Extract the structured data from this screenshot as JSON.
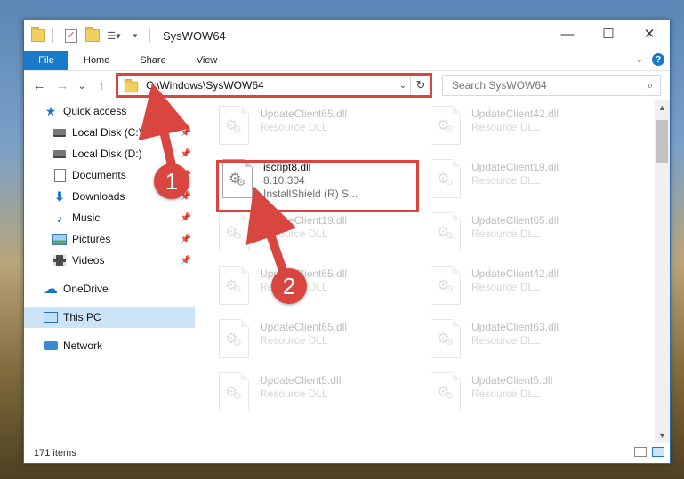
{
  "window": {
    "title": "SysWOW64",
    "controls": {
      "minimize": "—",
      "maximize": "☐",
      "close": "✕"
    }
  },
  "ribbon": {
    "file": "File",
    "tabs": [
      "Home",
      "Share",
      "View"
    ],
    "help": "?"
  },
  "navigation": {
    "back": "←",
    "forward": "→",
    "recent": "⌄",
    "up": "↑",
    "address": "C:\\Windows\\SysWOW64",
    "search_placeholder": "Search SysWOW64"
  },
  "sidebar": {
    "items": [
      {
        "label": "Quick access",
        "icon": "star-icon"
      },
      {
        "label": "Local Disk (C:)",
        "icon": "disk-icon",
        "pinned": true
      },
      {
        "label": "Local Disk (D:)",
        "icon": "disk-icon",
        "pinned": true
      },
      {
        "label": "Documents",
        "icon": "documents-icon",
        "pinned": true
      },
      {
        "label": "Downloads",
        "icon": "downloads-icon",
        "pinned": true
      },
      {
        "label": "Music",
        "icon": "music-icon",
        "pinned": true
      },
      {
        "label": "Pictures",
        "icon": "pictures-icon",
        "pinned": true
      },
      {
        "label": "Videos",
        "icon": "videos-icon",
        "pinned": true
      },
      {
        "label": "OneDrive",
        "icon": "onedrive-icon"
      },
      {
        "label": "This PC",
        "icon": "this-pc-icon",
        "selected": true
      },
      {
        "label": "Network",
        "icon": "network-icon"
      }
    ]
  },
  "files": {
    "highlighted": {
      "name": "iscript8.dll",
      "version": "8.10.304",
      "description": "InstallShield (R) S..."
    },
    "left_column": [
      {
        "name": "UpdateClient65.dll",
        "type": "Resource DLL"
      },
      {
        "name": "UpdateClient19.dll",
        "type": "Resource DLL"
      },
      {
        "name": "UpdateClient65.dll",
        "type": "Resource DLL"
      },
      {
        "name": "UpdateClient65.dll",
        "type": "Resource DLL"
      },
      {
        "name": "UpdateClient5.dll",
        "type": "Resource DLL"
      }
    ],
    "right_column": [
      {
        "name": "UpdateClient42.dll",
        "type": "Resource DLL"
      },
      {
        "name": "UpdateClient19.dll",
        "type": "Resource DLL"
      },
      {
        "name": "UpdateClient65.dll",
        "type": "Resource DLL"
      },
      {
        "name": "UpdateClient42.dll",
        "type": "Resource DLL"
      },
      {
        "name": "UpdateClient63.dll",
        "type": "Resource DLL"
      },
      {
        "name": "UpdateClient5.dll",
        "type": "Resource DLL"
      }
    ]
  },
  "status": {
    "count": "171 items"
  },
  "annotations": {
    "step1": "1",
    "step2": "2",
    "color": "#d9463f"
  }
}
